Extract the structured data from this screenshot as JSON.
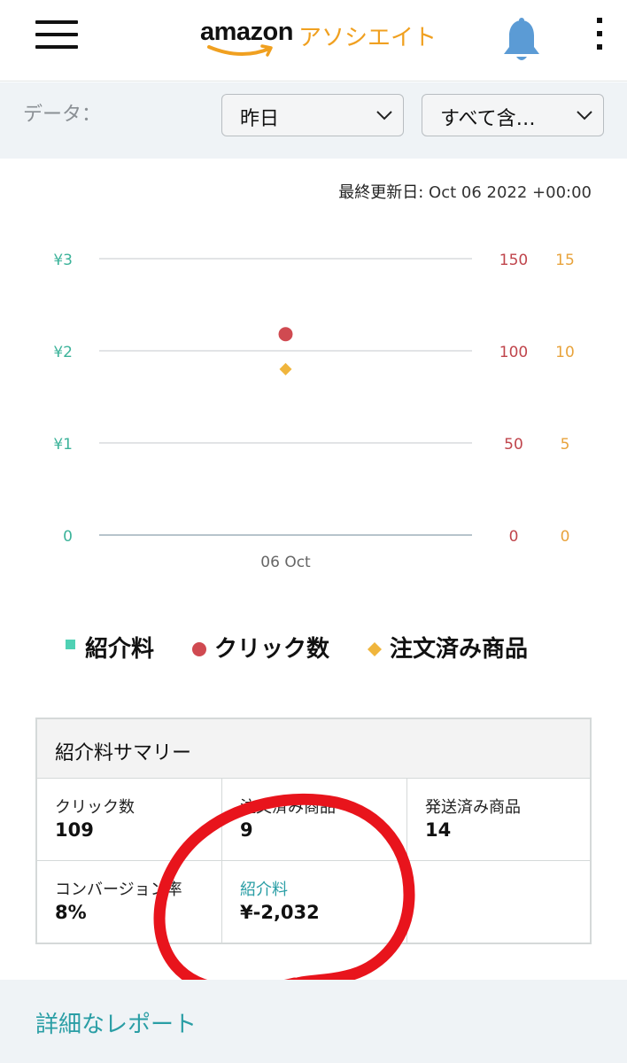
{
  "header": {
    "logo_amazon": "amazon",
    "logo_associates": "アソシエイト"
  },
  "filters": {
    "label": "データ：",
    "period_value": "昨日",
    "scope_value": "すべて含…"
  },
  "last_updated": {
    "label": "最終更新日:",
    "value": "Oct 06 2022 +00:00"
  },
  "chart_data": {
    "type": "scatter",
    "x": [
      "06 Oct"
    ],
    "axes": {
      "left": {
        "ticks": [
          "0",
          "¥1",
          "¥2",
          "¥3"
        ],
        "range": [
          0,
          3
        ],
        "color": "#3cb39a"
      },
      "right1": {
        "ticks": [
          "0",
          "50",
          "100",
          "150"
        ],
        "range": [
          0,
          150
        ],
        "color": "#c0454c"
      },
      "right2": {
        "ticks": [
          "0",
          "5",
          "10",
          "15"
        ],
        "range": [
          0,
          15
        ],
        "color": "#e8a33c"
      }
    },
    "series": [
      {
        "name": "紹介料",
        "axis": "left",
        "marker": "square",
        "color": "#4fd1b4",
        "values": [
          -2032
        ]
      },
      {
        "name": "クリック数",
        "axis": "right1",
        "marker": "circle",
        "color": "#d04a51",
        "values": [
          109
        ]
      },
      {
        "name": "注文済み商品",
        "axis": "right2",
        "marker": "diamond",
        "color": "#f0b53c",
        "values": [
          9
        ]
      }
    ],
    "grid": true,
    "legend": "bottom"
  },
  "summary": {
    "title": "紹介料サマリー",
    "clicks": {
      "label": "クリック数",
      "value": "109"
    },
    "ordered": {
      "label": "注文済み商品",
      "value": "9"
    },
    "shipped": {
      "label": "発送済み商品",
      "value": "14"
    },
    "conversion": {
      "label": "コンバージョン率",
      "value": "8%"
    },
    "fee": {
      "label": "紹介料",
      "value": "¥-2,032"
    }
  },
  "footer": {
    "link": "詳細なレポート"
  },
  "colors": {
    "accent_link": "#2a9ea5",
    "brand_orange": "#f0a020",
    "annotation_red": "#e8141c"
  }
}
